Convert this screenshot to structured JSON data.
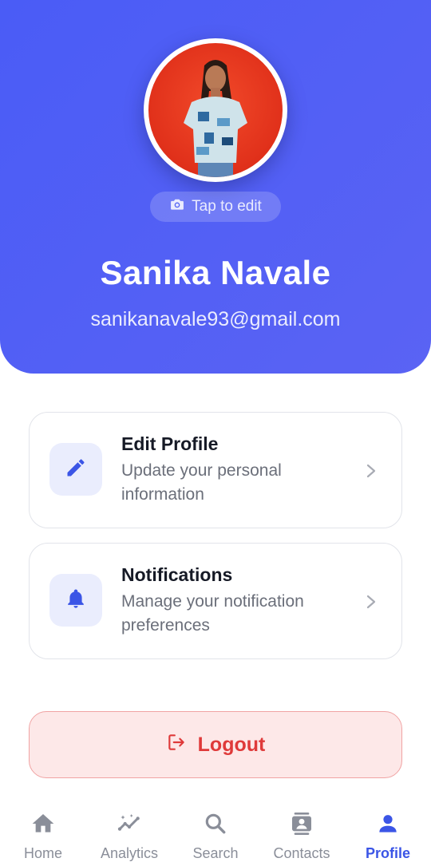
{
  "profile": {
    "tap_to_edit": "Tap to edit",
    "name": "Sanika Navale",
    "email": "sanikanavale93@gmail.com"
  },
  "menu": [
    {
      "title": "Edit Profile",
      "subtitle": "Update your personal information",
      "icon": "pencil-icon"
    },
    {
      "title": "Notifications",
      "subtitle": "Manage your notification preferences",
      "icon": "bell-icon"
    }
  ],
  "logout": {
    "label": "Logout",
    "icon": "logout-icon"
  },
  "nav": [
    {
      "label": "Home",
      "icon": "home-icon"
    },
    {
      "label": "Analytics",
      "icon": "analytics-icon"
    },
    {
      "label": "Search",
      "icon": "search-icon"
    },
    {
      "label": "Contacts",
      "icon": "contacts-icon"
    },
    {
      "label": "Profile",
      "icon": "person-icon",
      "active": true
    }
  ],
  "colors": {
    "header_gradient_start": "#4a5cf6",
    "accent": "#3b55e6",
    "logout_text": "#df3a3a",
    "logout_bg": "#fde8e8"
  }
}
